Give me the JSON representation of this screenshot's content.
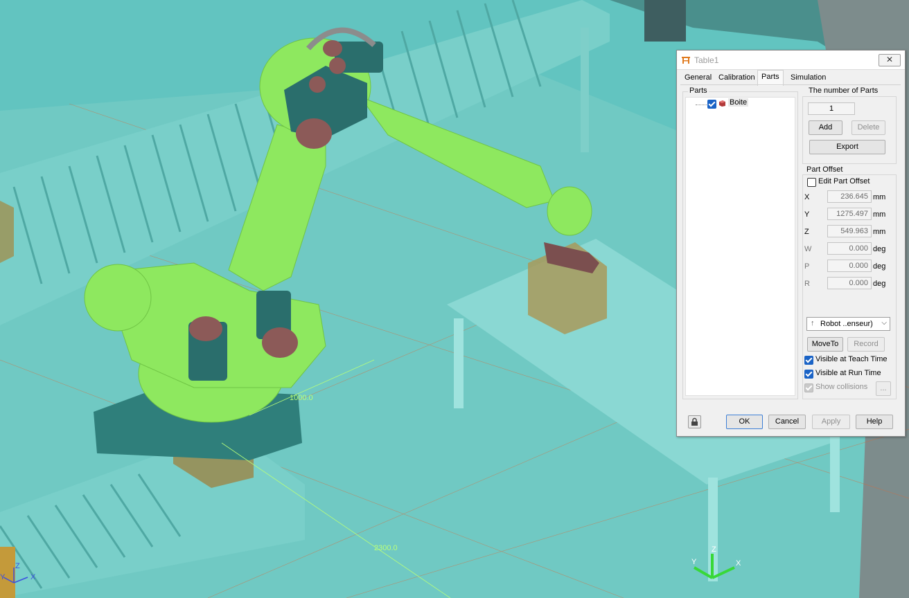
{
  "scene": {
    "dimension_labels": [
      "1000.0",
      "2300.0"
    ],
    "triad_left": {
      "y": "Y",
      "z": "Z",
      "x": "X"
    },
    "triad_right": {
      "y": "Y",
      "z": "Z",
      "x": "X"
    },
    "colors": {
      "floor": "#5fc9c4",
      "robot": "#8ee85f",
      "motor": "#2a6e6c",
      "cap": "#8c5a58",
      "box": "#9a8a4d"
    }
  },
  "dialog": {
    "title": "Table1",
    "close_label": "✕",
    "tabs": [
      "General",
      "Calibration",
      "Parts",
      "Simulation"
    ],
    "active_tab": "Parts",
    "parts": {
      "group_label": "Parts",
      "items": [
        {
          "label": "Boite",
          "checked": true
        }
      ]
    },
    "count": {
      "group_label": "The number of Parts",
      "value": "1",
      "add_label": "Add",
      "delete_label": "Delete",
      "export_label": "Export"
    },
    "offset": {
      "group_label": "Part Offset",
      "edit_label": "Edit Part Offset",
      "rows": [
        {
          "label": "X",
          "value": "236.645",
          "unit": "mm"
        },
        {
          "label": "Y",
          "value": "1275.497",
          "unit": "mm"
        },
        {
          "label": "Z",
          "value": "549.963",
          "unit": "mm"
        },
        {
          "label": "W",
          "value": "0.000",
          "unit": "deg"
        },
        {
          "label": "P",
          "value": "0.000",
          "unit": "deg"
        },
        {
          "label": "R",
          "value": "0.000",
          "unit": "deg"
        }
      ],
      "robot_select": "Robot ..enseur)",
      "moveto_label": "MoveTo",
      "record_label": "Record",
      "visible_teach": "Visible at Teach Time",
      "visible_run": "Visible at Run Time",
      "show_collisions": "Show collisions",
      "more_label": "..."
    },
    "buttons": {
      "ok": "OK",
      "cancel": "Cancel",
      "apply": "Apply",
      "help": "Help"
    }
  }
}
